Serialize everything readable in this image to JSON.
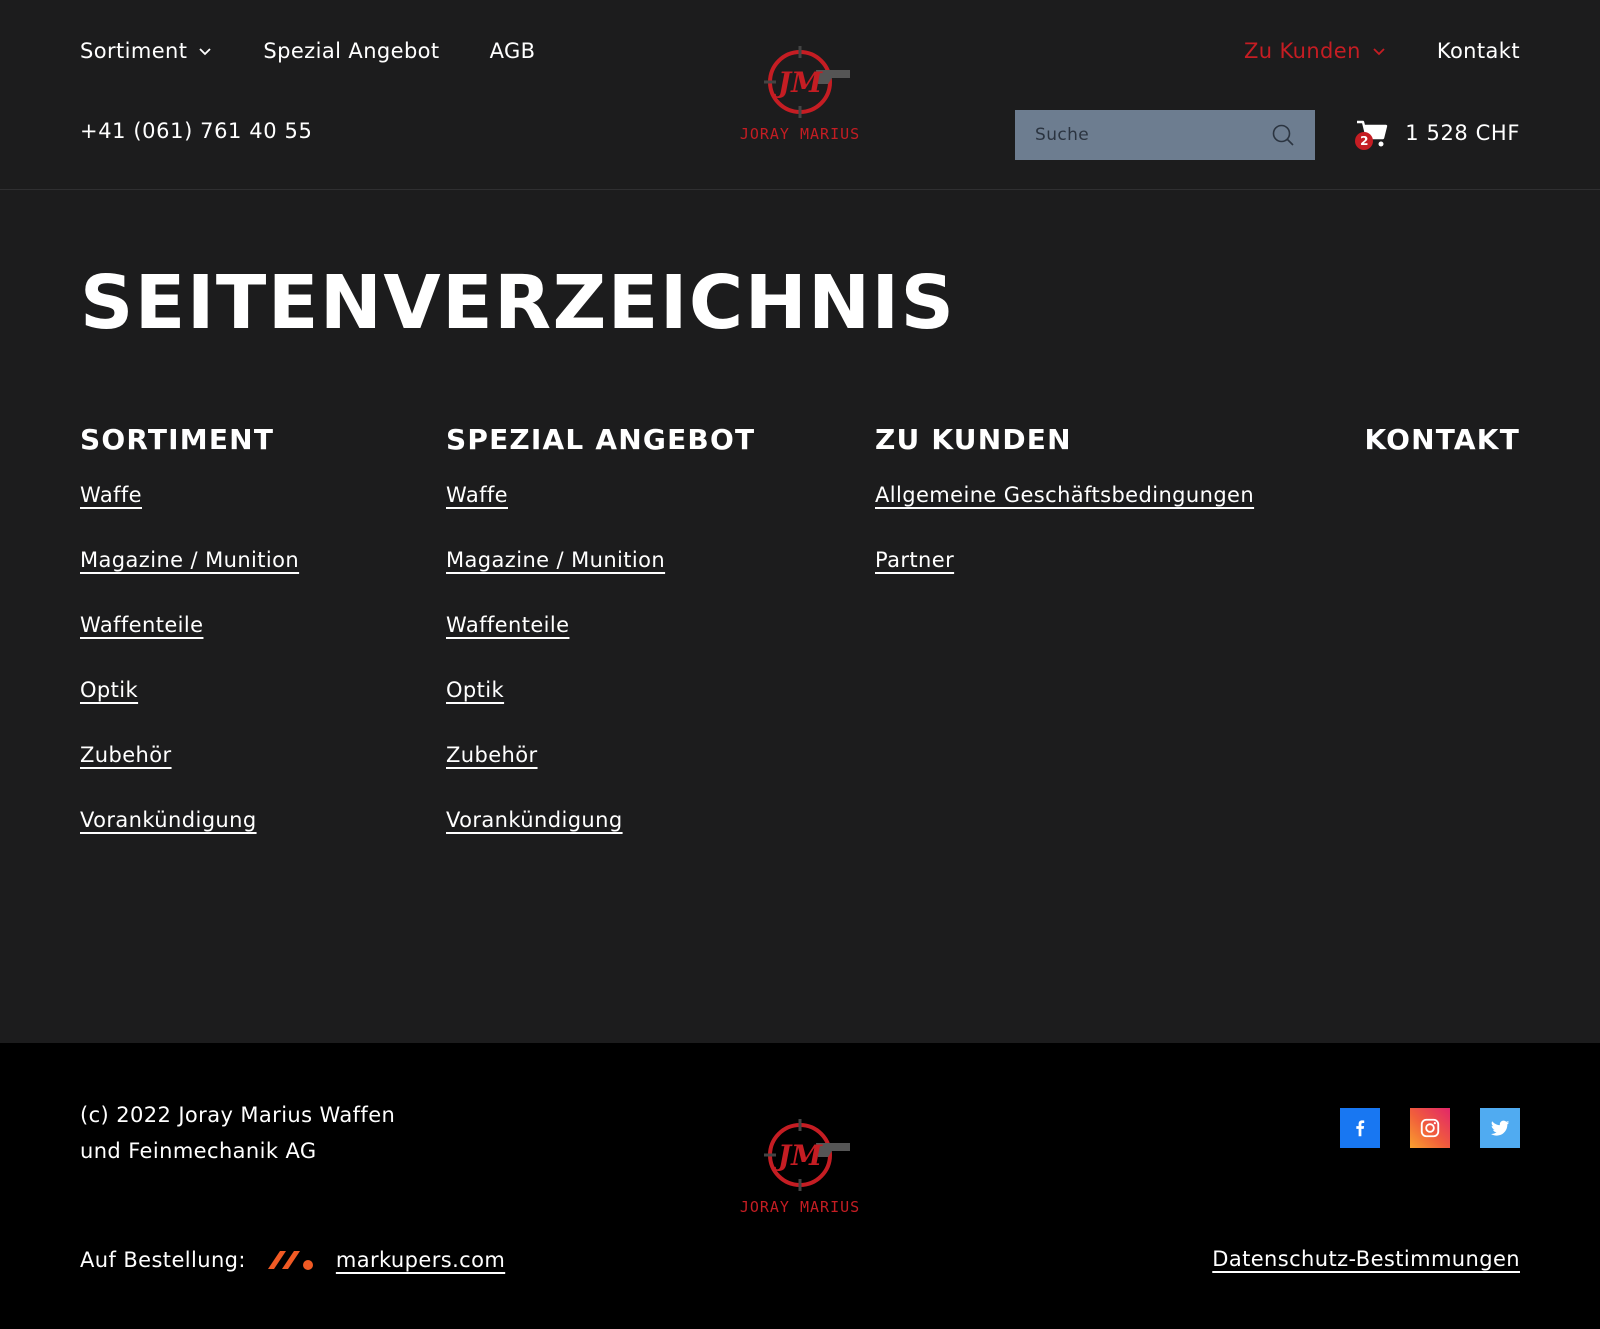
{
  "header": {
    "nav_left": [
      {
        "label": "Sortiment",
        "has_dropdown": true
      },
      {
        "label": "Spezial Angebot",
        "has_dropdown": false
      },
      {
        "label": "AGB",
        "has_dropdown": false
      }
    ],
    "nav_right": [
      {
        "label": "Zu Kunden",
        "has_dropdown": true,
        "active": true
      },
      {
        "label": "Kontakt",
        "has_dropdown": false
      }
    ],
    "phone": "+41 (061) 761 40 55",
    "logo_text": "JORAY MARIUS",
    "logo_mark": "JM",
    "search": {
      "placeholder": "Suche",
      "value": ""
    },
    "cart": {
      "count": "2",
      "total": "1 528 CHF"
    }
  },
  "main": {
    "title": "SEITENVERZEICHNIS",
    "columns": [
      {
        "heading": "SORTIMENT",
        "links": [
          "Waffe",
          "Magazine / Munition",
          "Waffenteile",
          "Optik",
          "Zubehör",
          "Vorankündigung"
        ]
      },
      {
        "heading": "SPEZIAL ANGEBOT",
        "links": [
          "Waffe",
          "Magazine / Munition",
          "Waffenteile",
          "Optik",
          "Zubehör",
          "Vorankündigung"
        ]
      },
      {
        "heading": "ZU KUNDEN",
        "links": [
          "Allgemeine Geschäftsbedingungen",
          "Partner"
        ]
      },
      {
        "heading": "KONTAKT",
        "links": []
      }
    ]
  },
  "footer": {
    "copyright": "(c) 2022 Joray Marius Waffen und Feinmechanik AG",
    "order_label": "Auf Bestellung:",
    "order_link": "markupers.com",
    "privacy_link": "Datenschutz-Bestimmungen",
    "socials": [
      "facebook-icon",
      "instagram-icon",
      "twitter-icon"
    ]
  },
  "colors": {
    "background": "#1c1c1d",
    "footer_background": "#000000",
    "accent": "#c51d23",
    "search_background": "#6d7d90",
    "markupers": "#f15a24"
  }
}
